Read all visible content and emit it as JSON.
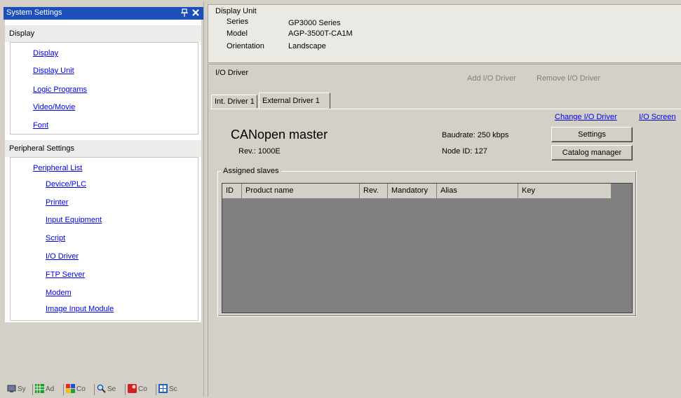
{
  "panel": {
    "title": "System Settings",
    "pin_icon": "pin-icon",
    "close_icon": "close-icon"
  },
  "display_section": {
    "header": "Display",
    "items": [
      "Display",
      "Display Unit",
      "Logic Programs",
      "Video/Movie",
      "Font"
    ]
  },
  "peripheral_section": {
    "header": "Peripheral Settings",
    "items": [
      "Peripheral List",
      "Device/PLC",
      "Printer",
      "Input Equipment",
      "Script",
      "I/O Driver",
      "FTP Server",
      "Modem",
      "Image Input Module"
    ]
  },
  "bottom_tabs": [
    {
      "label": "Sy",
      "icon": "system-settings-icon"
    },
    {
      "label": "Ad",
      "icon": "address-icon"
    },
    {
      "label": "Co",
      "icon": "common-settings-icon"
    },
    {
      "label": "Se",
      "icon": "search-icon"
    },
    {
      "label": "Co",
      "icon": "color-icon"
    },
    {
      "label": "Sc",
      "icon": "screen-list-icon"
    }
  ],
  "display_unit": {
    "title": "Display Unit",
    "series_label": "Series",
    "series_value": "GP3000 Series",
    "model_label": "Model",
    "model_value": "AGP-3500T-CA1M",
    "orientation_label": "Orientation",
    "orientation_value": "Landscape"
  },
  "io_driver": {
    "title": "I/O Driver",
    "add_label": "Add I/O Driver",
    "remove_label": "Remove I/O Driver",
    "tabs": [
      "Int. Driver 1",
      "External Driver 1"
    ],
    "active_tab": "External Driver 1",
    "change_link": "Change I/O Driver",
    "screen_link": "I/O Screen",
    "driver_name": "CANopen master",
    "rev": "Rev.: 1000E",
    "baudrate": "Baudrate: 250 kbps",
    "node_id": "Node ID: 127",
    "settings_button": "Settings",
    "catalog_button": "Catalog manager",
    "slaves_group": "Assigned slaves",
    "columns": [
      "ID",
      "Product name",
      "Rev.",
      "Mandatory",
      "Alias",
      "Key"
    ]
  },
  "colors": {
    "titlebar": "#1c4fba",
    "link": "#0000ee",
    "panel_bg": "#d4d0c8",
    "table_bg": "#808080"
  }
}
